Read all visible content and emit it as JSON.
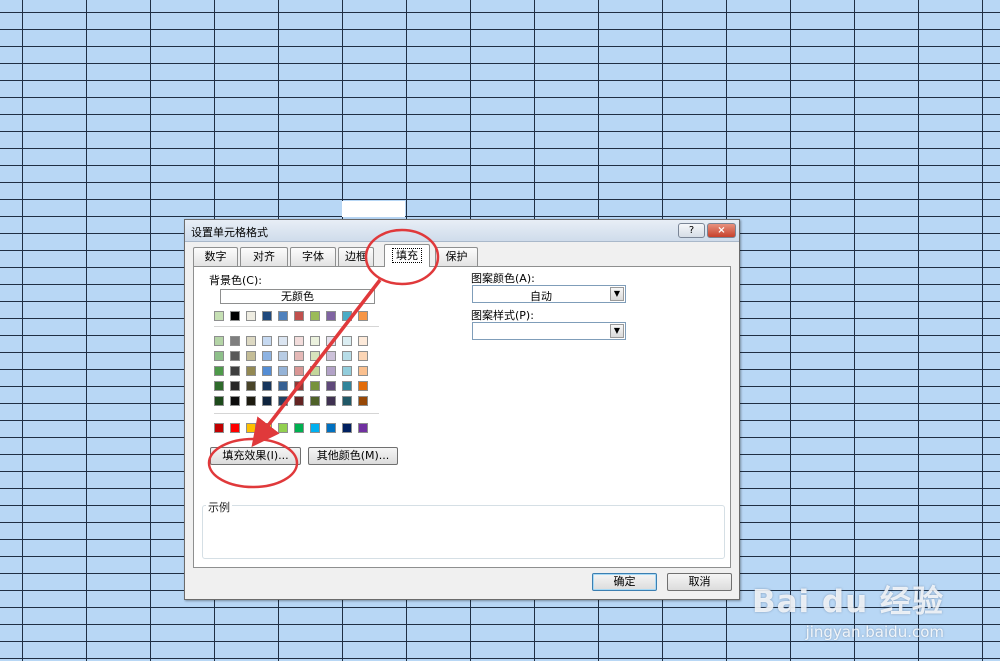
{
  "dialog": {
    "title": "设置单元格格式",
    "help_label": "?",
    "close_label": "×",
    "tabs": [
      {
        "label": "数字"
      },
      {
        "label": "对齐"
      },
      {
        "label": "字体"
      },
      {
        "label": "边框"
      },
      {
        "label": "填充"
      },
      {
        "label": "保护"
      }
    ],
    "background_color_label": "背景色(C):",
    "no_color_label": "无颜色",
    "fill_effects_label": "填充效果(I)...",
    "more_colors_label": "其他颜色(M)...",
    "pattern_color_label": "图案颜色(A):",
    "pattern_color_value": "自动",
    "pattern_style_label": "图案样式(P):",
    "pattern_style_value": "",
    "sample_label": "示例",
    "ok_label": "确定",
    "cancel_label": "取消"
  },
  "palette": {
    "theme_row": [
      "#c6e0b4",
      "#000000",
      "#eeece1",
      "#1f497d",
      "#4f81bd",
      "#c0504d",
      "#9bbb59",
      "#8064a2",
      "#4bacc6",
      "#f79646"
    ],
    "tint_rows": [
      [
        "#b4d4a6",
        "#7f7f7f",
        "#ddd9c3",
        "#c6d9f1",
        "#dbe5f1",
        "#f2dcdb",
        "#ebf1dd",
        "#e5e0ec",
        "#dbeef3",
        "#fdeada"
      ],
      [
        "#8ec08a",
        "#595959",
        "#c4bd97",
        "#8db3e2",
        "#b8cce4",
        "#e5b9b7",
        "#d7e3bc",
        "#ccc1d9",
        "#b7dde8",
        "#fbd5b5"
      ],
      [
        "#4e9a4a",
        "#3f3f3f",
        "#938953",
        "#548dd4",
        "#95b3d7",
        "#d99694",
        "#c3d69b",
        "#b2a2c7",
        "#92cddc",
        "#fac08f"
      ],
      [
        "#2f6b2c",
        "#262626",
        "#494429",
        "#17365d",
        "#366092",
        "#953734",
        "#76923c",
        "#5f497a",
        "#31859b",
        "#e36c09"
      ],
      [
        "#1d4a1b",
        "#0c0c0c",
        "#1d1b10",
        "#0f243e",
        "#244061",
        "#632423",
        "#4f6128",
        "#3f3151",
        "#205867",
        "#974806"
      ]
    ],
    "standard_row": [
      "#c00000",
      "#ff0000",
      "#ffc000",
      "#ffff00",
      "#92d050",
      "#00b050",
      "#00b0f0",
      "#0070c0",
      "#002060",
      "#7030a0"
    ]
  },
  "watermark": {
    "logo": "Bai du 经验",
    "url": "jingyan.baidu.com"
  },
  "annotation_color": "#e0393b"
}
